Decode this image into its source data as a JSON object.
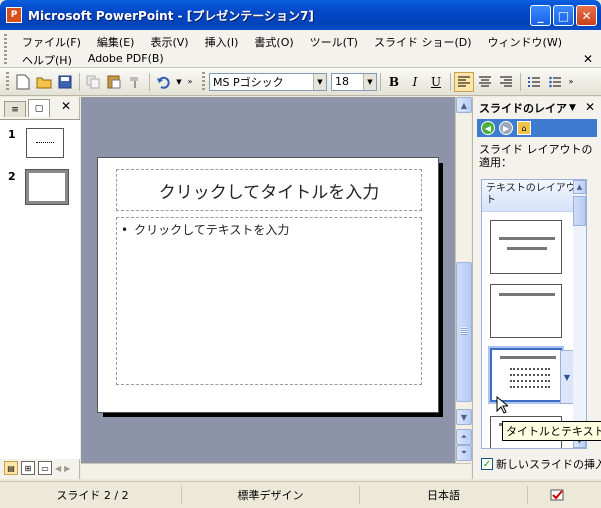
{
  "window": {
    "title": "Microsoft PowerPoint - [プレゼンテーション7]",
    "app_icon_label": "P"
  },
  "menu": {
    "row1": [
      "ファイル(F)",
      "編集(E)",
      "表示(V)",
      "挿入(I)",
      "書式(O)",
      "ツール(T)",
      "スライド ショー(D)",
      "ウィンドウ(W)"
    ],
    "row2": [
      "ヘルプ(H)",
      "Adobe PDF(B)"
    ]
  },
  "toolbar": {
    "font_name": "MS Pゴシック",
    "font_size": "18",
    "bold_label": "B",
    "italic_label": "I",
    "underline_label": "U"
  },
  "thumbnails": {
    "slides": [
      {
        "number": "1"
      },
      {
        "number": "2"
      }
    ]
  },
  "slide": {
    "title_placeholder": "クリックしてタイトルを入力",
    "body_bullet": "•",
    "body_placeholder": "クリックしてテキストを入力"
  },
  "taskpane": {
    "title": "スライドのレイア",
    "apply_label": "スライド レイアウトの適用：",
    "section_heading": "テキストのレイアウト",
    "tooltip": "タイトルとテキスト",
    "checkbox_label": "新しいスライドの挿入",
    "checkbox_checked": true
  },
  "status": {
    "slide_position": "スライド 2 / 2",
    "design": "標準デザイン",
    "language": "日本語"
  }
}
